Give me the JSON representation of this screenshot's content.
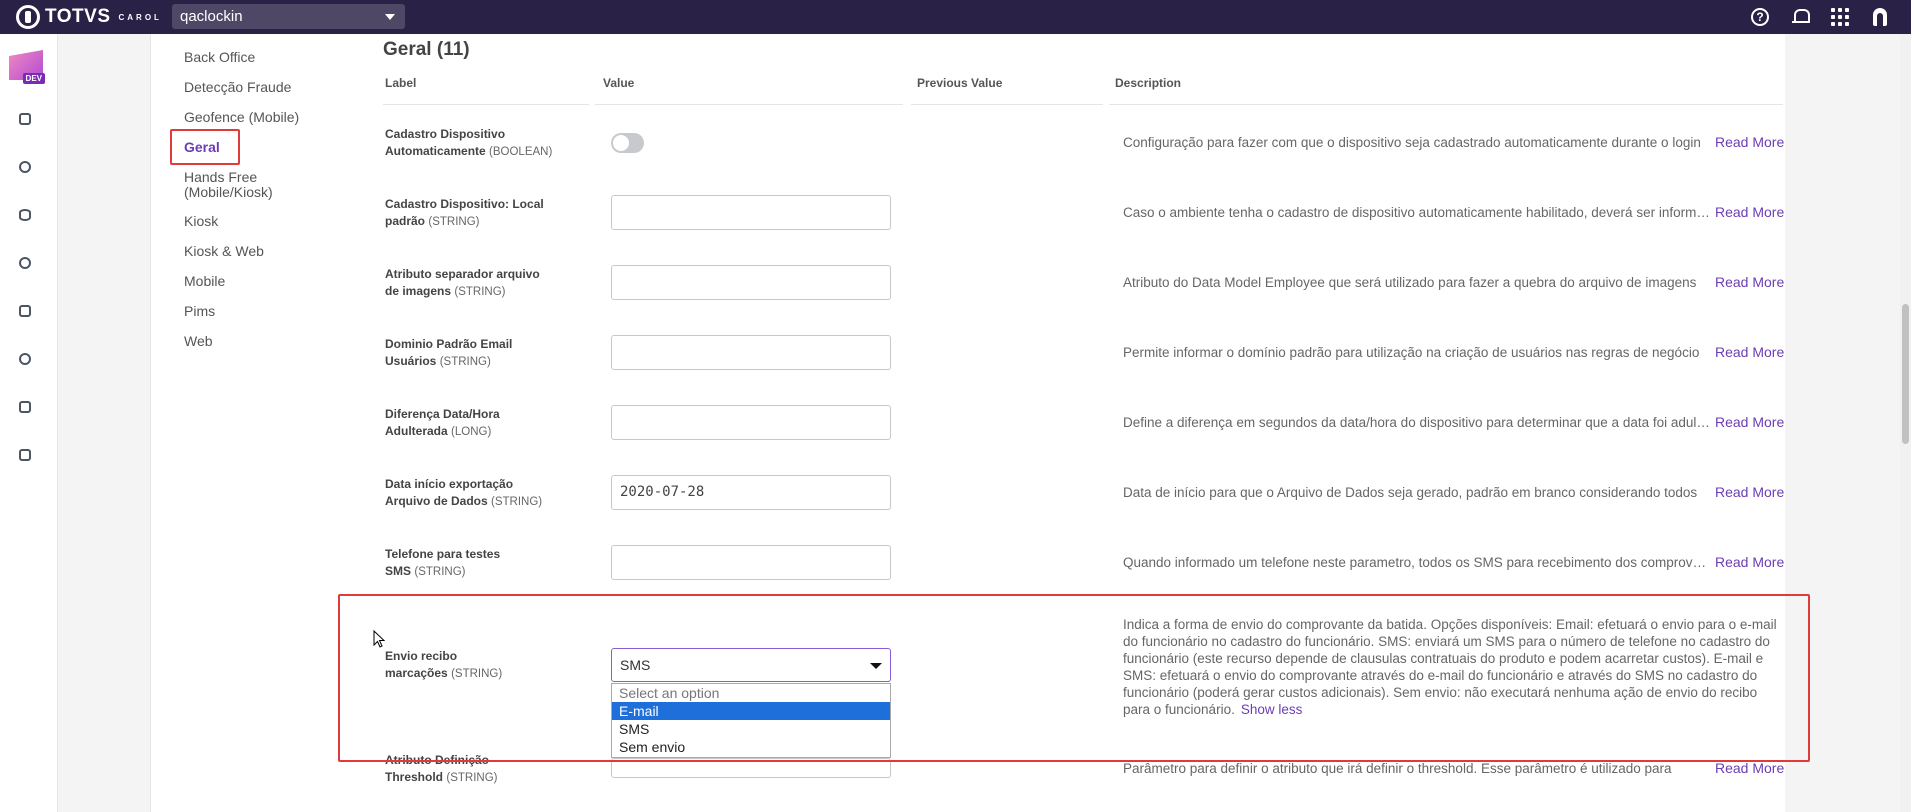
{
  "topbar": {
    "brand": "TOTVS",
    "brand_sub": "CAROL",
    "tenant": "qaclockin"
  },
  "rail": {
    "badge": "DEV"
  },
  "subnav": {
    "items": [
      "Back Office",
      "Detecção Fraude",
      "Geofence (Mobile)",
      "Geral",
      "Hands Free (Mobile/Kiosk)",
      "Kiosk",
      "Kiosk & Web",
      "Mobile",
      "Pims",
      "Web"
    ],
    "active": "Geral"
  },
  "main": {
    "title": "Geral (11)",
    "columns": {
      "label": "Label",
      "value": "Value",
      "previous": "Previous Value",
      "description": "Description"
    },
    "read_more": "Read More",
    "show_less": "Show less",
    "rows": [
      {
        "label": "Cadastro Dispositivo Automaticamente",
        "type": "(BOOLEAN)",
        "value": "",
        "desc": "Configuração para fazer com que o dispositivo seja cadastrado automaticamente durante o login"
      },
      {
        "label": "Cadastro Dispositivo: Local padrão",
        "type": "(STRING)",
        "value": "",
        "desc": "Caso o ambiente tenha o cadastro de dispositivo automaticamente habilitado, deverá ser informado"
      },
      {
        "label": "Atributo separador arquivo de imagens",
        "type": "(STRING)",
        "value": "",
        "desc": "Atributo do Data Model Employee que será utilizado para fazer a quebra do arquivo de imagens"
      },
      {
        "label": "Dominio Padrão Email Usuários",
        "type": "(STRING)",
        "value": "",
        "desc": "Permite informar o domínio padrão para utilização na criação de usuários nas regras de negócio"
      },
      {
        "label": "Diferença Data/Hora Adulterada",
        "type": "(LONG)",
        "value": "",
        "desc": "Define a diferença em segundos da data/hora do dispositivo para determinar que a data foi adulterada"
      },
      {
        "label": "Data início exportação Arquivo de Dados",
        "type": "(STRING)",
        "value": "2020-07-28",
        "desc": "Data de início para que o Arquivo de Dados seja gerado, padrão em branco considerando todos"
      },
      {
        "label": "Telefone para testes SMS",
        "type": "(STRING)",
        "value": "",
        "desc": "Quando informado um telefone neste parametro, todos os SMS para recebimento dos comprovantes"
      },
      {
        "label": "Envio recibo marcações",
        "type": "(STRING)",
        "value": "SMS",
        "desc": "Indica a forma de envio do comprovante da batida. Opções disponíveis: Email: efetuará o envio para o e-mail do funcionário no cadastro do funcionário. SMS: enviará um SMS para o número de telefone no cadastro do funcionário (este recurso depende de clausulas contratuais do produto e podem acarretar custos). E-mail e SMS: efetuará o envio do comprovante através do e-mail do funcionário e através do SMS no cadastro do funcionário (poderá gerar custos adicionais). Sem envio: não executará nenhuma ação de envio do recibo para o funcionário."
      },
      {
        "label": "Atributo Definição Threshold",
        "type": "(STRING)",
        "value": "",
        "desc": "Parâmetro para definir o atributo que irá definir o threshold. Esse parâmetro é utilizado para"
      }
    ],
    "dropdown_options": [
      "Select an option",
      "E-mail",
      "SMS",
      "Sem envio"
    ],
    "dropdown_highlighted": "E-mail"
  },
  "colors": {
    "topbar": "#2a2147",
    "accent": "#6c3db5",
    "highlight": "#e03a3a",
    "option_selected": "#1e6fd9"
  }
}
